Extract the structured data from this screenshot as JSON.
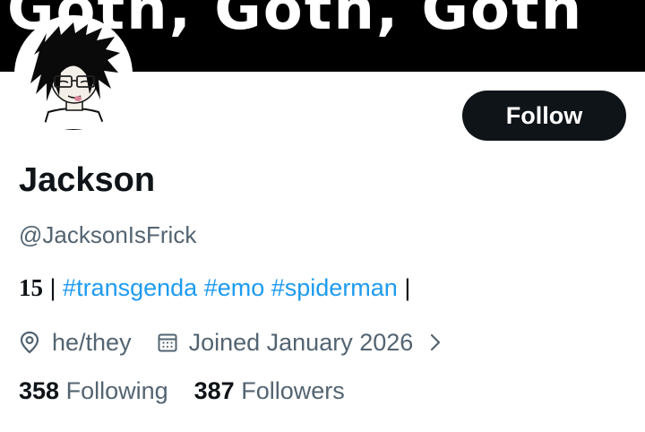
{
  "banner": {
    "text": "Goth, Goth, Goth"
  },
  "profile": {
    "display_name": "Jackson",
    "handle": "@JacksonIsFrick",
    "follow_label": "Follow",
    "bio": {
      "age": "15",
      "separator": "|",
      "hashtags": [
        "#transgenda",
        "#emo",
        "#spiderman"
      ],
      "trailing": "|"
    },
    "pronouns": "he/they",
    "joined": "Joined January 2026",
    "icons": {
      "location": "location-pin-icon",
      "calendar": "calendar-icon",
      "chevron": "chevron-right-icon"
    }
  },
  "stats": {
    "following_count": "358",
    "following_label": "Following",
    "followers_count": "387",
    "followers_label": "Followers"
  },
  "colors": {
    "accent": "#1d9bf0",
    "text": "#0f1419",
    "muted": "#536471",
    "button": "#0f1419"
  }
}
